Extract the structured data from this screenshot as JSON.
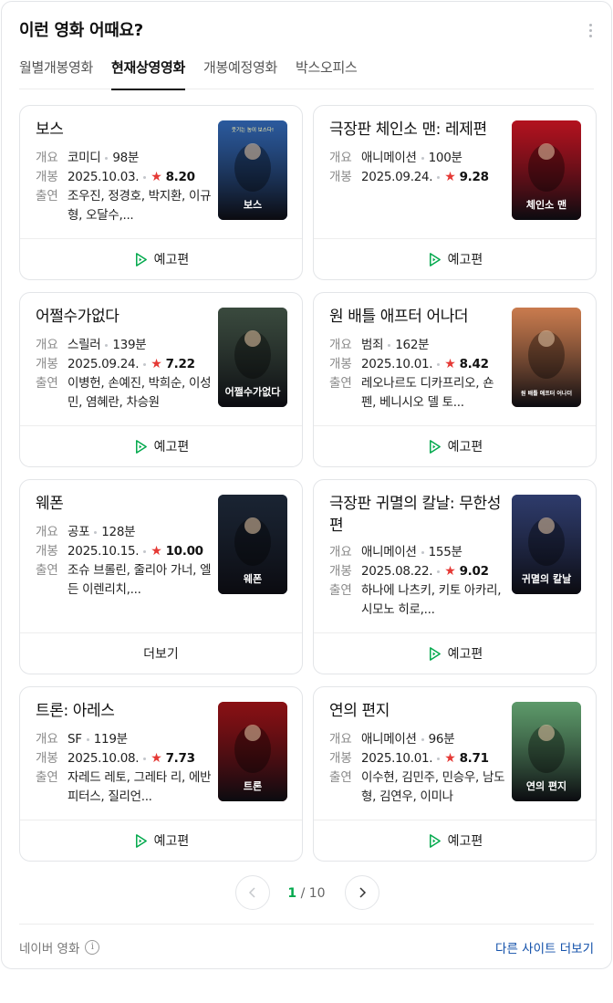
{
  "header": {
    "title": "이런 영화 어때요?"
  },
  "tabs": [
    {
      "label": "월별개봉영화",
      "active": false
    },
    {
      "label": "현재상영영화",
      "active": true
    },
    {
      "label": "개봉예정영화",
      "active": false
    },
    {
      "label": "박스오피스",
      "active": false
    }
  ],
  "labels": {
    "genre_key": "개요",
    "release_key": "개봉",
    "cast_key": "출연"
  },
  "movies": [
    {
      "title": "보스",
      "genre": "코미디",
      "runtime": "98분",
      "release": "2025.10.03.",
      "rating": "8.20",
      "cast": "조우진, 정경호, 박지환, 이규형, 오달수,...",
      "action": "예고편",
      "poster_color": "#2b5a9e",
      "poster_text": "보스",
      "poster_tagline": "웃기는 놈이 보스다!"
    },
    {
      "title": "극장판 체인소 맨: 레제편",
      "genre": "애니메이션",
      "runtime": "100분",
      "release": "2025.09.24.",
      "rating": "9.28",
      "cast": "",
      "action": "예고편",
      "poster_color": "#b3121f",
      "poster_text": "체인소 맨"
    },
    {
      "title": "어쩔수가없다",
      "genre": "스릴러",
      "runtime": "139분",
      "release": "2025.09.24.",
      "rating": "7.22",
      "cast": "이병헌, 손예진, 박희순, 이성민, 염혜란, 차승원",
      "action": "예고편",
      "poster_color": "#3a4a3e",
      "poster_text": "어쩔수가없다"
    },
    {
      "title": "원 배틀 애프터 어나더",
      "genre": "범죄",
      "runtime": "162분",
      "release": "2025.10.01.",
      "rating": "8.42",
      "cast": "레오나르도 디카프리오, 숀 펜, 베니시오 델 토...",
      "action": "예고편",
      "poster_color": "#c97b4e",
      "poster_text": "원 배틀 애프터 어나더"
    },
    {
      "title": "웨폰",
      "genre": "공포",
      "runtime": "128분",
      "release": "2025.10.15.",
      "rating": "10.00",
      "cast": "조슈 브롤린, 줄리아 가너, 엘든 이렌리치,...",
      "action": "더보기",
      "poster_color": "#1a2433",
      "poster_text": "웨폰"
    },
    {
      "title": "극장판 귀멸의 칼날: 무한성편",
      "genre": "애니메이션",
      "runtime": "155분",
      "release": "2025.08.22.",
      "rating": "9.02",
      "cast": "하나에 나츠키, 키토 아카리, 시모노 히로,...",
      "action": "예고편",
      "poster_color": "#2e3b6b",
      "poster_text": "귀멸의 칼날"
    },
    {
      "title": "트론: 아레스",
      "genre": "SF",
      "runtime": "119분",
      "release": "2025.10.08.",
      "rating": "7.73",
      "cast": "자레드 레토, 그레타 리, 에반 피터스, 질리언...",
      "action": "예고편",
      "poster_color": "#8a1014",
      "poster_text": "트론"
    },
    {
      "title": "연의 편지",
      "genre": "애니메이션",
      "runtime": "96분",
      "release": "2025.10.01.",
      "rating": "8.71",
      "cast": "이수현, 김민주, 민승우, 남도형, 김연우, 이미나",
      "action": "예고편",
      "poster_color": "#5d9a6a",
      "poster_text": "연의 편지"
    }
  ],
  "pagination": {
    "current": "1",
    "separator": "/",
    "total": "10"
  },
  "footer": {
    "source": "네이버 영화",
    "more_link": "다른 사이트 더보기"
  },
  "colors": {
    "accent_green": "#03a94d",
    "star_red": "#e53935",
    "link_blue": "#0f4ea9"
  }
}
